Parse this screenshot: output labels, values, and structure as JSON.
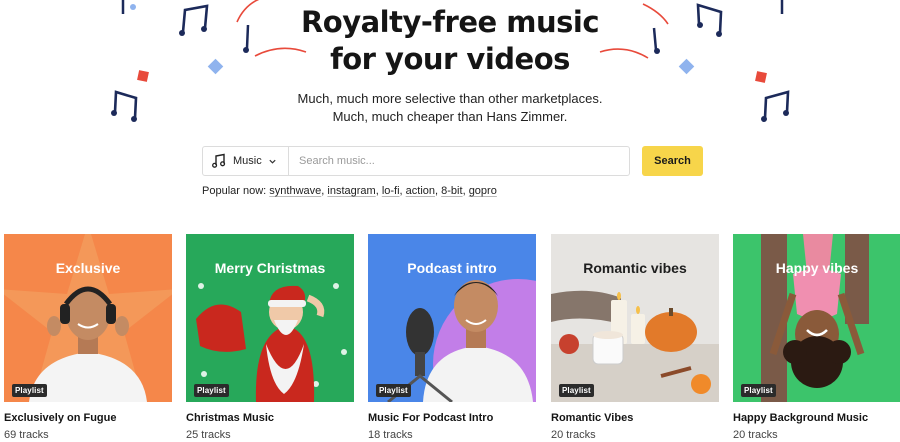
{
  "hero": {
    "title_line1": "Royalty-free music",
    "title_line2": "for your videos",
    "subtitle": "Much, much more selective than other marketplaces. Much, much cheaper than Hans Zimmer."
  },
  "search": {
    "category_label": "Music",
    "placeholder": "Search music...",
    "button_label": "Search"
  },
  "popular": {
    "label": "Popular now:",
    "tags": [
      "synthwave",
      "instagram",
      "lo-fi",
      "action",
      "8-bit",
      "gopro"
    ]
  },
  "cards": [
    {
      "thumb_title": "Exclusive",
      "badge": "Playlist",
      "name": "Exclusively on Fugue",
      "count": "69 tracks",
      "bg": "#f5874a"
    },
    {
      "thumb_title": "Merry Christmas",
      "badge": "Playlist",
      "name": "Christmas Music",
      "count": "25 tracks",
      "bg": "#27a85a"
    },
    {
      "thumb_title": "Podcast intro",
      "badge": "Playlist",
      "name": "Music For Podcast Intro",
      "count": "18 tracks",
      "bg": "#4a86e8"
    },
    {
      "thumb_title": "Romantic vibes",
      "badge": "Playlist",
      "name": "Romantic Vibes",
      "count": "20 tracks",
      "bg": "#e4e2df"
    },
    {
      "thumb_title": "Happy vibes",
      "badge": "Playlist",
      "name": "Happy Background Music",
      "count": "20 tracks",
      "bg": "#3cc46b"
    }
  ],
  "colors": {
    "accent": "#f7d54a",
    "decor_navy": "#1c2a5a",
    "decor_red": "#e84a3b",
    "decor_blue": "#8fb3ee"
  }
}
